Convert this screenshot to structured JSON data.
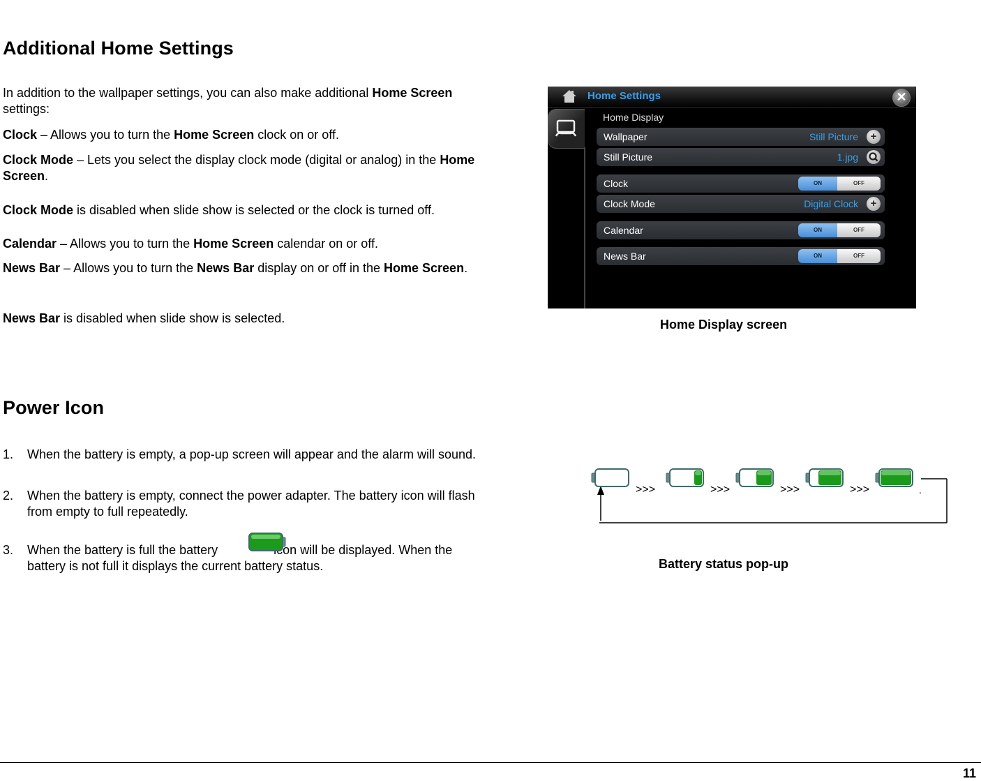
{
  "section1": {
    "heading": "Additional Home Settings",
    "intro": {
      "pre": "In addition to the wallpaper settings, you can also make additional ",
      "bold": "Home Screen",
      "post": " settings:"
    },
    "items": [
      {
        "term": "Clock",
        "pre": " – Allows you to turn the ",
        "bold": "Home Screen",
        "post": " clock on or off."
      },
      {
        "term": "Clock Mode",
        "pre": " – Lets you select the display clock mode (digital or analog) in the ",
        "bold": "Home Screen",
        "post": "."
      },
      {
        "term": "Clock Mode",
        "pre": " is disabled when slide show is selected or the clock is turned off."
      },
      {
        "term": "Calendar",
        "pre": " – Allows you to turn the ",
        "bold": "Home Screen",
        "post": " calendar on or off."
      },
      {
        "term": "News Bar",
        "pre": " – Allows you to turn the ",
        "bold": "News Bar",
        "mid": " display on or off in the ",
        "bold2": "Home Screen",
        "post": "."
      },
      {
        "term": "News Bar",
        "pre": " is disabled when slide show is selected."
      }
    ]
  },
  "screenshot": {
    "title": "Home Settings",
    "close_label": "✕",
    "section": "Home Display",
    "rows": [
      {
        "label": "Wallpaper",
        "value": "Still Picture",
        "action": "+"
      },
      {
        "label": "Still Picture",
        "value": "1.jpg",
        "action": "🔍"
      },
      {
        "label": "Clock",
        "on": "ON",
        "off": "OFF",
        "state": "on"
      },
      {
        "label": "Clock Mode",
        "value": "Digital Clock",
        "action": "+"
      },
      {
        "label": "Calendar",
        "on": "ON",
        "off": "OFF",
        "state": "on"
      },
      {
        "label": "News Bar",
        "on": "ON",
        "off": "OFF",
        "state": "on"
      }
    ],
    "caption": "Home Display screen"
  },
  "section2": {
    "heading": "Power Icon",
    "list": [
      {
        "num": "1.",
        "text": "When the battery is empty, a pop-up screen will appear and the alarm will sound."
      },
      {
        "num": "2.",
        "text": "When the battery is empty, connect the power adapter.  The battery icon will flash from empty to full repeatedly."
      },
      {
        "num": "3.",
        "pre": "When the battery is full the battery",
        "post": "icon will be displayed.  When the battery is not full it displays the current battery status."
      }
    ]
  },
  "battery_popup": {
    "levels": [
      0,
      0.25,
      0.5,
      0.75,
      1.0
    ],
    "separator": ">>>",
    "caption": "Battery status pop-up",
    "colors": {
      "fill": "#1c9a1c",
      "outline": "#3f6b6b"
    }
  },
  "footer": {
    "page_number": "11"
  }
}
